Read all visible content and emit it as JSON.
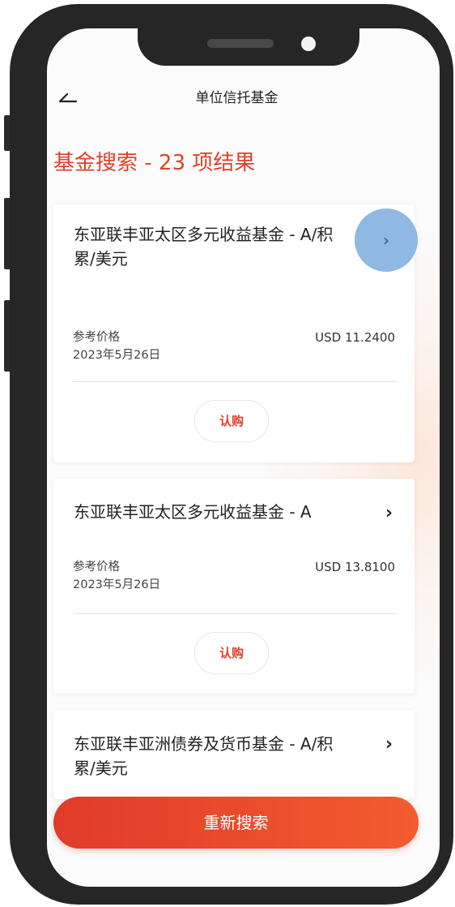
{
  "header": {
    "title": "单位信托基金",
    "results_heading": "基金搜索 - 23 项结果"
  },
  "funds": [
    {
      "name": "东亚联丰亚太区多元收益基金 - A/积累/美元",
      "price_label": "参考价格",
      "price_date": "2023年5月26日",
      "price": "USD 11.2400",
      "action_label": "认购"
    },
    {
      "name": "东亚联丰亚太区多元收益基金 - A",
      "price_label": "参考价格",
      "price_date": "2023年5月26日",
      "price": "USD 13.8100",
      "action_label": "认购"
    },
    {
      "name": "东亚联丰亚洲债券及货币基金 - A/积累/美元"
    }
  ],
  "footer": {
    "research_label": "重新搜索"
  },
  "icons": {
    "back": "back-arrow-icon",
    "chevron": "chevron-right-icon",
    "chevron_glyph": "›"
  },
  "colors": {
    "accent": "#e1402b",
    "highlight": "#8fb8e2",
    "frame": "#262626"
  }
}
